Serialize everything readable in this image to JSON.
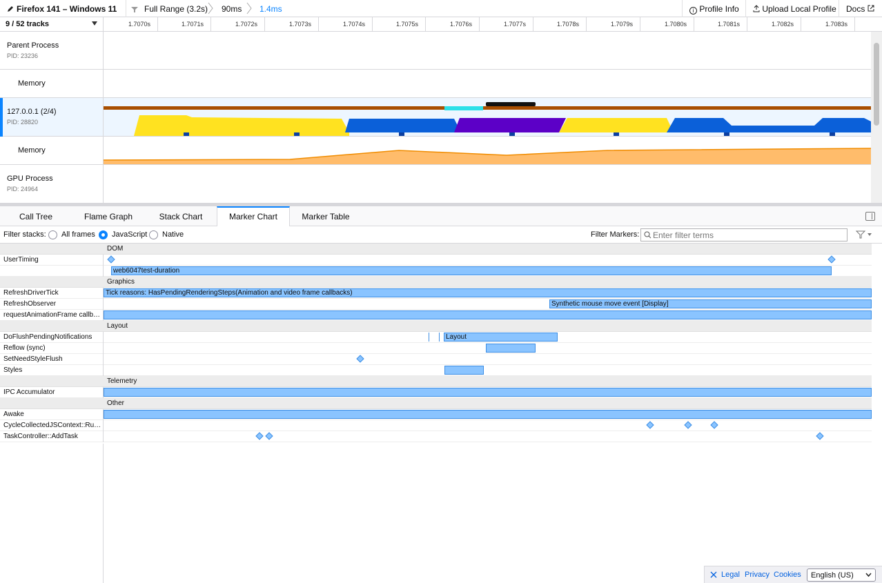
{
  "topbar": {
    "title": "Firefox 141 – Windows 11",
    "breadcrumbs": [
      "Full Range (3.2s)",
      "90ms",
      "1.4ms"
    ],
    "buttons": {
      "profile_info": "Profile Info",
      "upload": "Upload Local Profile",
      "docs": "Docs"
    }
  },
  "timeline": {
    "track_count": "9 / 52 tracks",
    "ticks": [
      "1.7070s",
      "1.7071s",
      "1.7072s",
      "1.7073s",
      "1.7074s",
      "1.7075s",
      "1.7076s",
      "1.7077s",
      "1.7078s",
      "1.7079s",
      "1.7080s",
      "1.7081s",
      "1.7082s",
      "1.7083s"
    ],
    "tracks": [
      {
        "name": "Parent Process",
        "pid": "PID: 23236"
      },
      {
        "name": "Memory"
      },
      {
        "name": "127.0.0.1 (2/4)",
        "pid": "PID: 28820"
      },
      {
        "name": "Memory"
      },
      {
        "name": "GPU Process",
        "pid": "PID: 24964"
      }
    ],
    "colors": {
      "yellow": "#ffe220",
      "blue": "#0b60d9",
      "purple": "#5c00c7",
      "brown": "#a84e00",
      "memory": "#ffbc6b"
    }
  },
  "tabs": [
    "Call Tree",
    "Flame Graph",
    "Stack Chart",
    "Marker Chart",
    "Marker Table"
  ],
  "active_tab": "Marker Chart",
  "filter": {
    "label": "Filter stacks:",
    "options": [
      "All frames",
      "JavaScript",
      "Native"
    ],
    "selected": "JavaScript",
    "markers_label": "Filter Markers:",
    "placeholder": "Enter filter terms"
  },
  "markers": {
    "rows": [
      {
        "category": "DOM"
      },
      {
        "label": "UserTiming"
      },
      {
        "label": "",
        "bar_text": "web6047test-duration"
      },
      {
        "category": "Graphics"
      },
      {
        "label": "RefreshDriverTick",
        "bar_text": "Tick reasons: HasPendingRenderingSteps(Animation and video frame callbacks)"
      },
      {
        "label": "RefreshObserver",
        "bar_text": "Synthetic mouse move event [Display]"
      },
      {
        "label": "requestAnimationFrame callb…"
      },
      {
        "category": "Layout"
      },
      {
        "label": "DoFlushPendingNotifications",
        "bar_text": "Layout"
      },
      {
        "label": "Reflow (sync)"
      },
      {
        "label": "SetNeedStyleFlush"
      },
      {
        "label": "Styles"
      },
      {
        "category": "Telemetry"
      },
      {
        "label": "IPC Accumulator"
      },
      {
        "category": "Other"
      },
      {
        "label": "Awake"
      },
      {
        "label": "CycleCollectedJSContext::Ru…"
      },
      {
        "label": "TaskController::AddTask"
      }
    ]
  },
  "footer": {
    "links": [
      "Legal",
      "Privacy",
      "Cookies"
    ],
    "language": "English (US)"
  }
}
